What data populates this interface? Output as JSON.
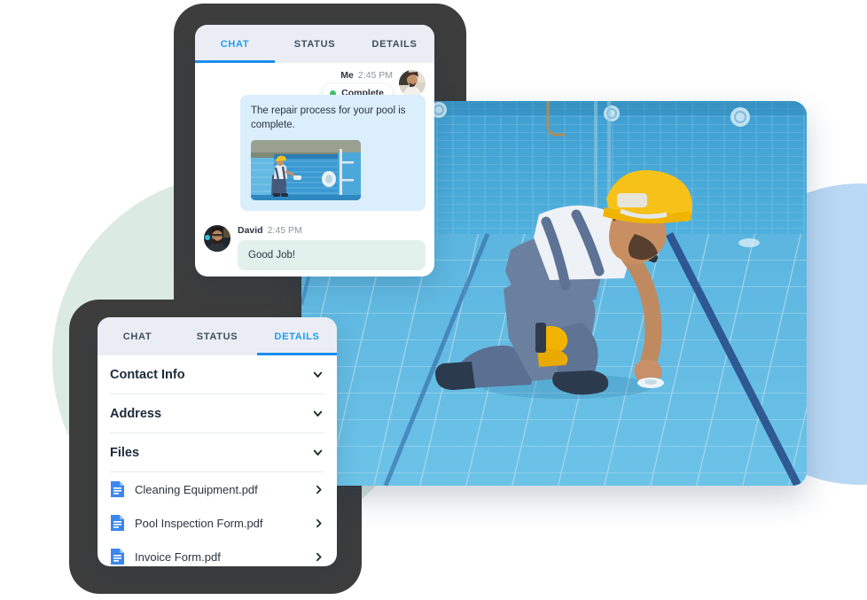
{
  "theme": {
    "accent": "#1b8ded",
    "accent_text": "#1f9cf0",
    "status_green": "#3fbf6a",
    "frame_dark": "#3d3d3d",
    "blob_mint": "#dbeae2",
    "blob_blue": "#b9d8f5",
    "bubble_out": "#dbeefc",
    "bubble_in": "#e3f1ec",
    "tabbar_bg": "#eaeef4"
  },
  "chat_panel": {
    "tabs": [
      {
        "label": "CHAT",
        "active": true
      },
      {
        "label": "STATUS",
        "active": false
      },
      {
        "label": "DETAILS",
        "active": false
      }
    ],
    "outgoing": {
      "sender": "Me",
      "time": "2:45 PM",
      "status_badge": "Complete",
      "status_icon": "green-dot-icon",
      "text": "The repair process for your pool is complete.",
      "attachment_alt": "pool-wall-repair-photo",
      "avatar_alt": "me-avatar"
    },
    "incoming": {
      "sender": "David",
      "time": "2:45 PM",
      "text": "Good Job!",
      "avatar_alt": "david-avatar"
    }
  },
  "details_panel": {
    "tabs": [
      {
        "label": "CHAT",
        "active": false
      },
      {
        "label": "STATUS",
        "active": false
      },
      {
        "label": "DETAILS",
        "active": true
      }
    ],
    "sections": [
      {
        "title": "Contact Info",
        "icon": "chevron-down-icon"
      },
      {
        "title": "Address",
        "icon": "chevron-down-icon"
      },
      {
        "title": "Files",
        "icon": "chevron-down-icon"
      }
    ],
    "files": [
      {
        "name": "Cleaning Equipment.pdf",
        "icon": "pdf-document-icon",
        "chevron": "chevron-right-icon"
      },
      {
        "name": "Pool Inspection Form.pdf",
        "icon": "pdf-document-icon",
        "chevron": "chevron-right-icon"
      },
      {
        "name": "Invoice Form.pdf",
        "icon": "pdf-document-icon",
        "chevron": "chevron-right-icon"
      }
    ]
  },
  "hero": {
    "alt": "pool-technician-kneeling-in-empty-tiled-pool"
  }
}
